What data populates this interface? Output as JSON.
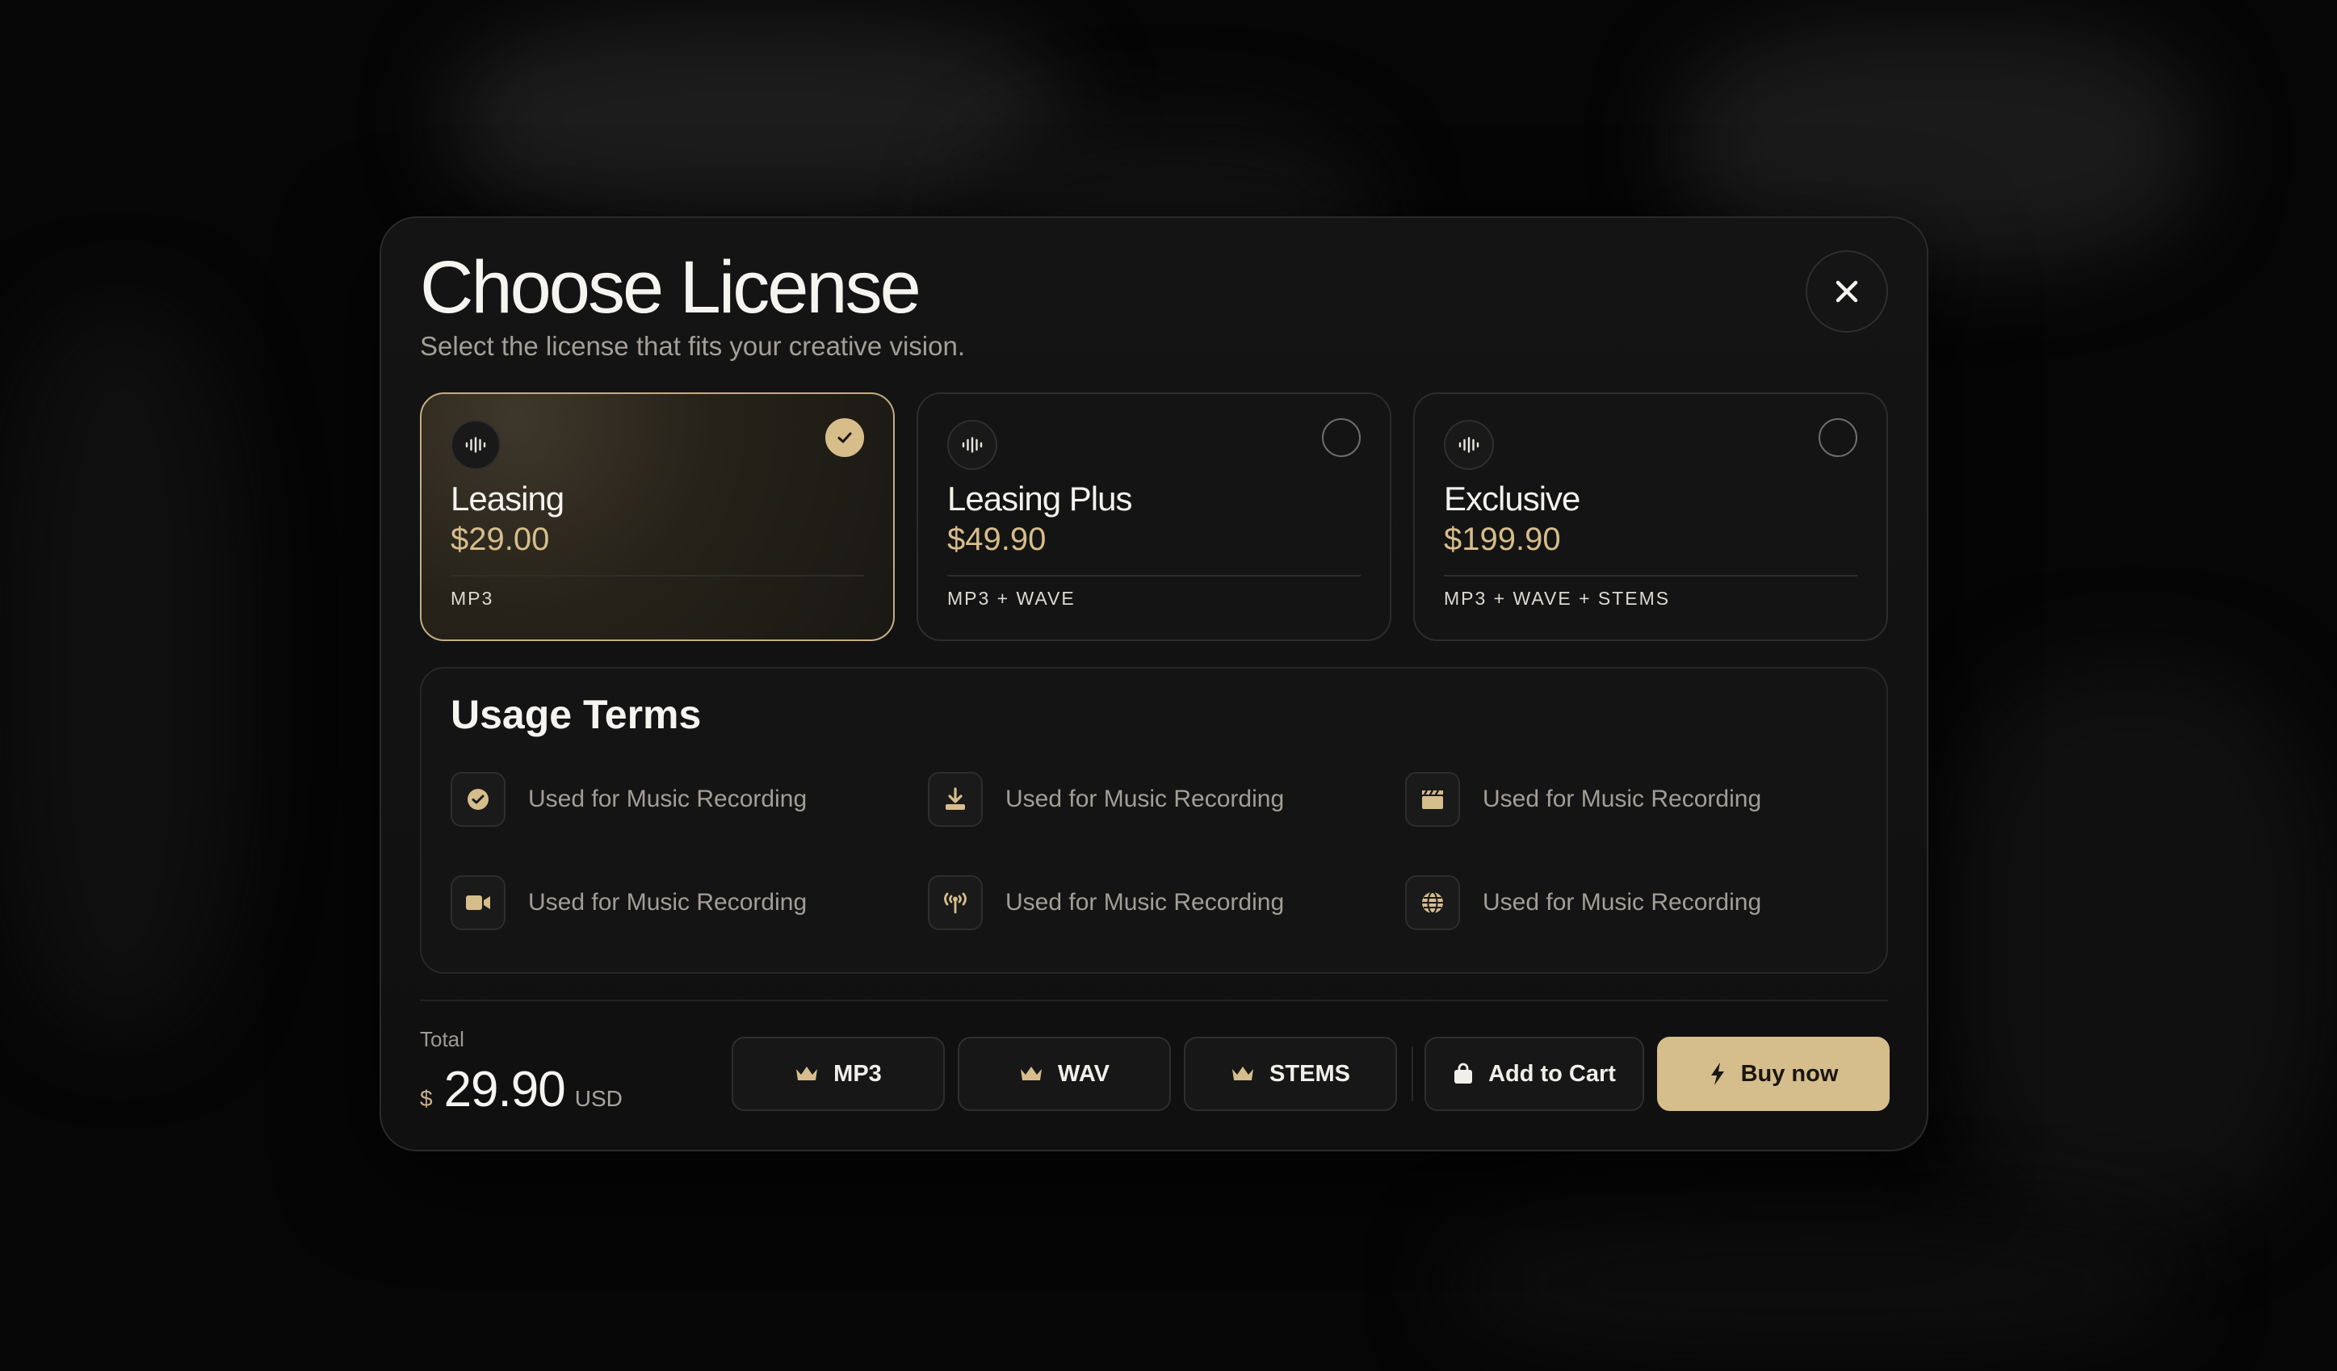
{
  "modal": {
    "title": "Choose License",
    "subtitle": "Select the license that fits your creative vision.",
    "close_icon": "close-icon"
  },
  "licenses": [
    {
      "name": "Leasing",
      "price": "$29.00",
      "formats": "MP3",
      "selected": true,
      "icon": "waveform-icon"
    },
    {
      "name": "Leasing Plus",
      "price": "$49.90",
      "formats": "MP3 + WAVE",
      "selected": false,
      "icon": "waveform-icon"
    },
    {
      "name": "Exclusive",
      "price": "$199.90",
      "formats": "MP3 + WAVE + STEMS",
      "selected": false,
      "icon": "waveform-icon"
    }
  ],
  "usage_terms": {
    "title": "Usage Terms",
    "items": [
      {
        "icon": "check-circle-icon",
        "label": "Used for Music Recording"
      },
      {
        "icon": "download-icon",
        "label": "Used for Music Recording"
      },
      {
        "icon": "clapperboard-icon",
        "label": "Used for Music Recording"
      },
      {
        "icon": "video-camera-icon",
        "label": "Used for Music Recording"
      },
      {
        "icon": "broadcast-antenna-icon",
        "label": "Used for Music Recording"
      },
      {
        "icon": "globe-icon",
        "label": "Used for Music Recording"
      }
    ]
  },
  "total": {
    "label": "Total",
    "currency_symbol": "$",
    "amount": "29.90",
    "currency": "USD"
  },
  "actions": {
    "mp3": "MP3",
    "wav": "WAV",
    "stems": "STEMS",
    "add_to_cart": "Add to Cart",
    "buy_now": "Buy now"
  },
  "colors": {
    "accent_gold": "#d5bd8c",
    "background": "#060606",
    "modal_bg": "#121212",
    "text_muted": "#a29e97"
  }
}
